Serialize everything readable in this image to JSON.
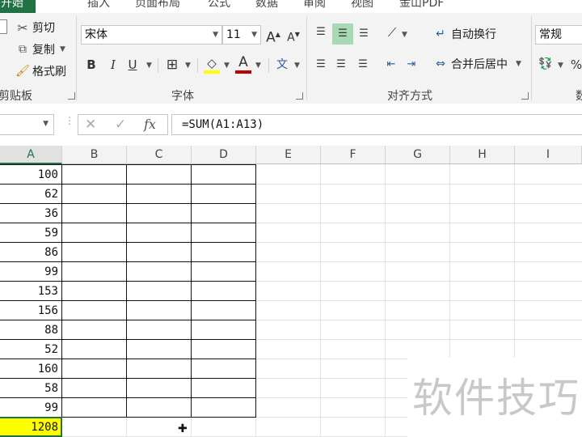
{
  "ribbon_tabs": [
    {
      "label": "开始",
      "active": true
    },
    {
      "label": "插入",
      "active": false
    },
    {
      "label": "页面布局",
      "active": false
    },
    {
      "label": "公式",
      "active": false
    },
    {
      "label": "数据",
      "active": false
    },
    {
      "label": "审阅",
      "active": false
    },
    {
      "label": "视图",
      "active": false
    },
    {
      "label": "金山PDF",
      "active": false
    }
  ],
  "clipboard": {
    "cut_label": "剪切",
    "copy_label": "复制",
    "format_painter_label": "格式刷",
    "group_label": "剪贴板"
  },
  "font": {
    "font_name": "宋体",
    "font_size": "11",
    "bold": "B",
    "italic": "I",
    "underline": "U",
    "grow": "A",
    "shrink": "A",
    "font_color_letter": "A",
    "phonetic": "文",
    "group_label": "字体",
    "highlight_color": "#ffff00",
    "font_color": "#c00000"
  },
  "alignment": {
    "wrap_text_label": "自动换行",
    "merge_center_label": "合并后居中",
    "group_label": "对齐方式"
  },
  "number": {
    "format_value": "常规",
    "percent": "%",
    "group_label_partial": "数"
  },
  "formula_bar": {
    "cancel": "✕",
    "enter": "✓",
    "fx": "fx",
    "formula": "=SUM(A1:A13)"
  },
  "columns": [
    "A",
    "B",
    "C",
    "D",
    "E",
    "F",
    "G",
    "H",
    "I"
  ],
  "selected_column": "A",
  "column_a_values": [
    "100",
    "62",
    "36",
    "59",
    "86",
    "99",
    "153",
    "156",
    "88",
    "52",
    "160",
    "58",
    "99"
  ],
  "sum_value": "1208",
  "watermark": "软件技巧",
  "accent_color": "#217346"
}
